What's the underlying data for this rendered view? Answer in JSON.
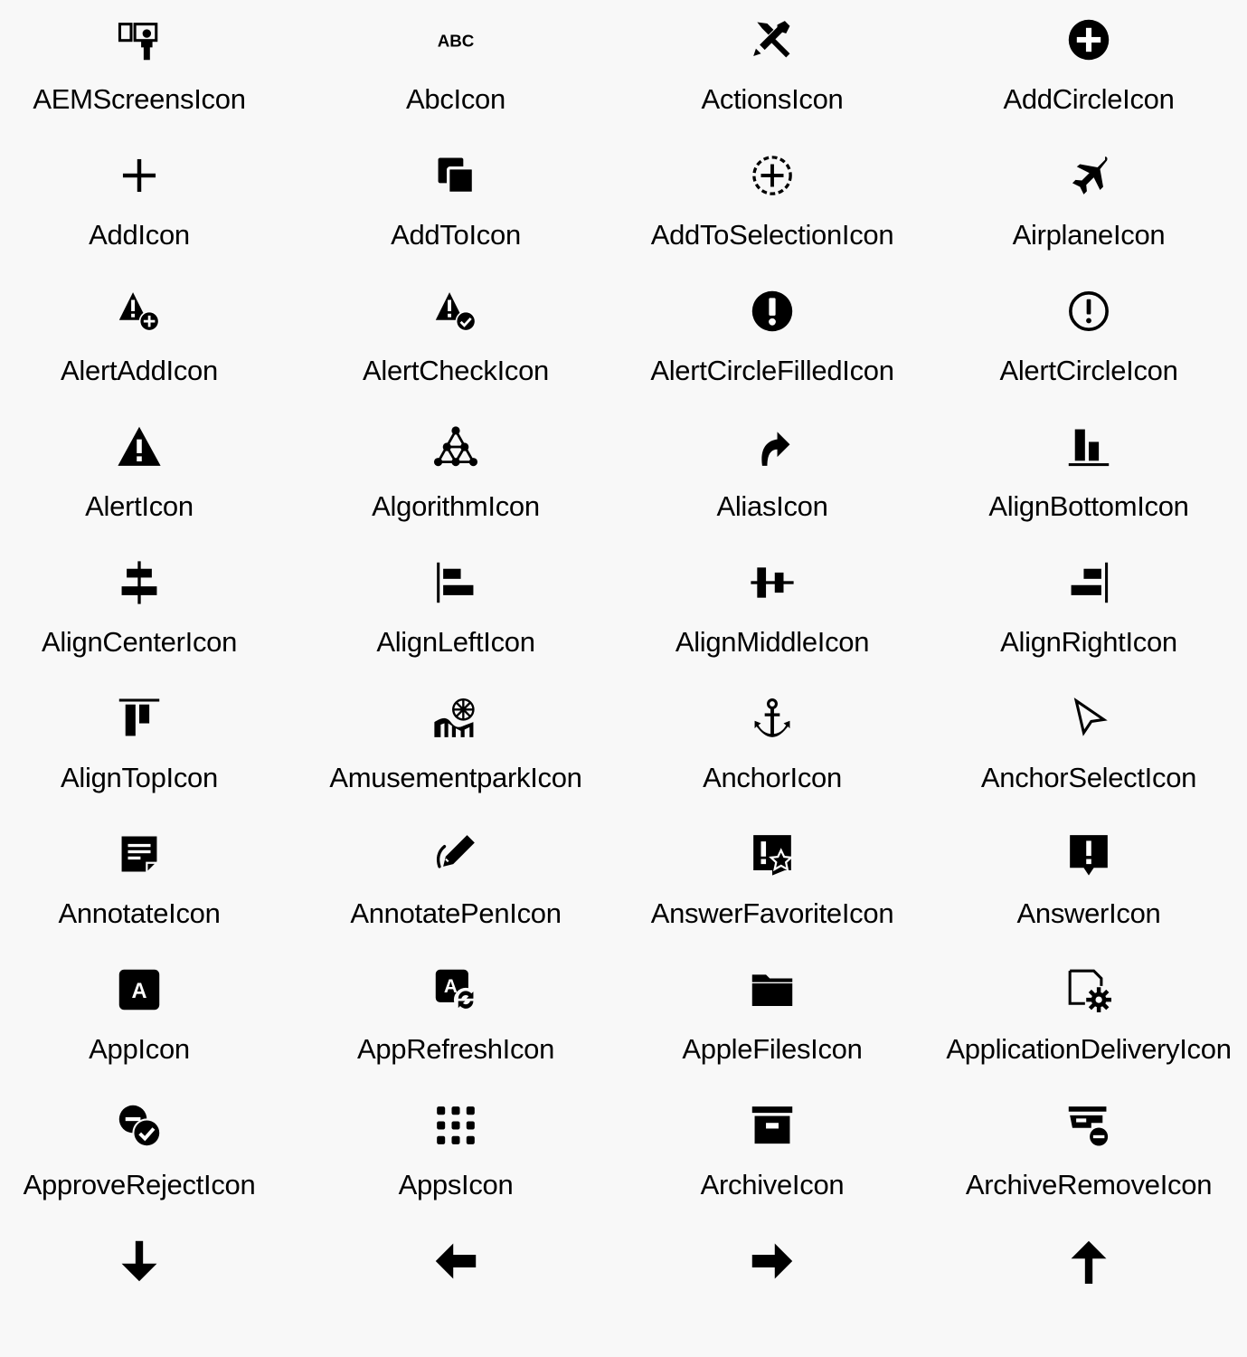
{
  "icon_color": "#000000",
  "background": "#f8f8f8",
  "icons": [
    {
      "name": "AEMScreensIcon",
      "glyph": "aem-screens-icon"
    },
    {
      "name": "AbcIcon",
      "glyph": "abc-icon",
      "text": "ABC"
    },
    {
      "name": "ActionsIcon",
      "glyph": "actions-icon"
    },
    {
      "name": "AddCircleIcon",
      "glyph": "add-circle-icon"
    },
    {
      "name": "AddIcon",
      "glyph": "add-icon"
    },
    {
      "name": "AddToIcon",
      "glyph": "add-to-icon"
    },
    {
      "name": "AddToSelectionIcon",
      "glyph": "add-to-selection-icon"
    },
    {
      "name": "AirplaneIcon",
      "glyph": "airplane-icon"
    },
    {
      "name": "AlertAddIcon",
      "glyph": "alert-add-icon"
    },
    {
      "name": "AlertCheckIcon",
      "glyph": "alert-check-icon"
    },
    {
      "name": "AlertCircleFilledIcon",
      "glyph": "alert-circle-filled-icon"
    },
    {
      "name": "AlertCircleIcon",
      "glyph": "alert-circle-icon"
    },
    {
      "name": "AlertIcon",
      "glyph": "alert-icon"
    },
    {
      "name": "AlgorithmIcon",
      "glyph": "algorithm-icon"
    },
    {
      "name": "AliasIcon",
      "glyph": "alias-icon"
    },
    {
      "name": "AlignBottomIcon",
      "glyph": "align-bottom-icon"
    },
    {
      "name": "AlignCenterIcon",
      "glyph": "align-center-icon"
    },
    {
      "name": "AlignLeftIcon",
      "glyph": "align-left-icon"
    },
    {
      "name": "AlignMiddleIcon",
      "glyph": "align-middle-icon"
    },
    {
      "name": "AlignRightIcon",
      "glyph": "align-right-icon"
    },
    {
      "name": "AlignTopIcon",
      "glyph": "align-top-icon"
    },
    {
      "name": "AmusementparkIcon",
      "glyph": "amusement-park-icon"
    },
    {
      "name": "AnchorIcon",
      "glyph": "anchor-icon"
    },
    {
      "name": "AnchorSelectIcon",
      "glyph": "anchor-select-icon"
    },
    {
      "name": "AnnotateIcon",
      "glyph": "annotate-icon"
    },
    {
      "name": "AnnotatePenIcon",
      "glyph": "annotate-pen-icon"
    },
    {
      "name": "AnswerFavoriteIcon",
      "glyph": "answer-favorite-icon"
    },
    {
      "name": "AnswerIcon",
      "glyph": "answer-icon"
    },
    {
      "name": "AppIcon",
      "glyph": "app-icon",
      "text": "A"
    },
    {
      "name": "AppRefreshIcon",
      "glyph": "app-refresh-icon",
      "text": "A"
    },
    {
      "name": "AppleFilesIcon",
      "glyph": "apple-files-icon"
    },
    {
      "name": "ApplicationDeliveryIcon",
      "glyph": "application-delivery-icon"
    },
    {
      "name": "ApproveRejectIcon",
      "glyph": "approve-reject-icon"
    },
    {
      "name": "AppsIcon",
      "glyph": "apps-icon"
    },
    {
      "name": "ArchiveIcon",
      "glyph": "archive-icon"
    },
    {
      "name": "ArchiveRemoveIcon",
      "glyph": "archive-remove-icon"
    },
    {
      "name": "",
      "glyph": "arrow-down-icon"
    },
    {
      "name": "",
      "glyph": "arrow-left-icon"
    },
    {
      "name": "",
      "glyph": "arrow-right-icon"
    },
    {
      "name": "",
      "glyph": "arrow-up-icon"
    }
  ]
}
